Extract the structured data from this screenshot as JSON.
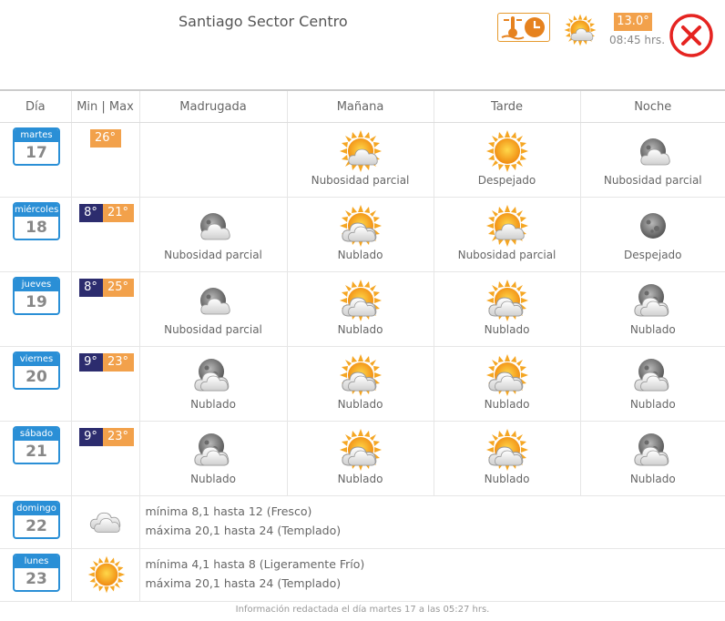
{
  "header": {
    "location": "Santiago Sector Centro",
    "current_temp": "13.0°",
    "current_time": "08:45 hrs.",
    "history_icon": "thermometer-clock-icon",
    "close_icon": "close-circle-icon"
  },
  "columns": {
    "day": "Día",
    "minmax": "Min | Max",
    "madrugada": "Madrugada",
    "manana": "Mañana",
    "tarde": "Tarde",
    "noche": "Noche"
  },
  "days": [
    {
      "weekday": "martes",
      "num": "17",
      "min": "",
      "max": "26°",
      "madrugada": "",
      "manana": "Nubosidad parcial",
      "tarde": "Despejado",
      "noche": "Nubosidad parcial"
    },
    {
      "weekday": "miércoles",
      "num": "18",
      "min": "8°",
      "max": "21°",
      "madrugada": "Nubosidad parcial",
      "manana": "Nublado",
      "tarde": "Nubosidad parcial",
      "noche": "Despejado"
    },
    {
      "weekday": "jueves",
      "num": "19",
      "min": "8°",
      "max": "25°",
      "madrugada": "Nubosidad parcial",
      "manana": "Nublado",
      "tarde": "Nublado",
      "noche": "Nublado"
    },
    {
      "weekday": "viernes",
      "num": "20",
      "min": "9°",
      "max": "23°",
      "madrugada": "Nublado",
      "manana": "Nublado",
      "tarde": "Nublado",
      "noche": "Nublado"
    },
    {
      "weekday": "sábado",
      "num": "21",
      "min": "9°",
      "max": "23°",
      "madrugada": "Nublado",
      "manana": "Nublado",
      "tarde": "Nublado",
      "noche": "Nublado"
    }
  ],
  "summary": [
    {
      "weekday": "domingo",
      "num": "22",
      "icon": "cloudy-icon",
      "line1": "mínima 8,1 hasta 12 (Fresco)",
      "line2": "máxima 20,1 hasta 24 (Templado)"
    },
    {
      "weekday": "lunes",
      "num": "23",
      "icon": "sun-icon",
      "line1": "mínima 4,1 hasta 8 (Ligeramente Frío)",
      "line2": "máxima 20,1 hasta 24 (Templado)"
    }
  ],
  "footer": "Información redactada el día martes 17 a las 05:27 hrs.",
  "colors": {
    "accent_blue": "#2a8fd6",
    "min_bg": "#2c2c6e",
    "max_bg": "#f2a14b",
    "close_red": "#e52421"
  }
}
